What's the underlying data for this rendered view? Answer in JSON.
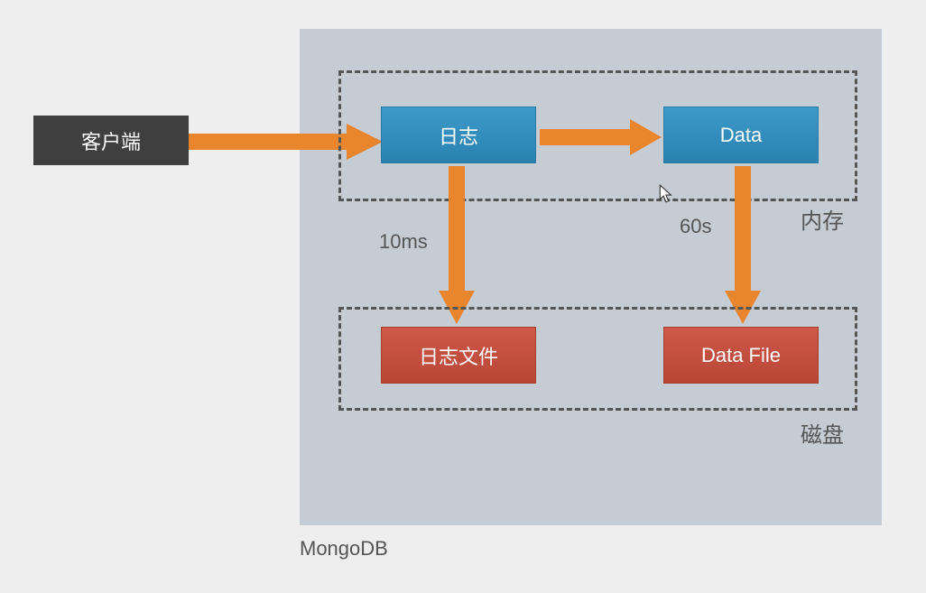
{
  "diagram": {
    "client": "客户端",
    "mongodb_label": "MongoDB",
    "memory_label": "内存",
    "disk_label": "磁盘",
    "log_box": "日志",
    "data_box": "Data",
    "logfile_box": "日志文件",
    "datafile_box": "Data File",
    "time_10ms": "10ms",
    "time_60s": "60s"
  },
  "chart_data": {
    "type": "diagram",
    "title": "MongoDB",
    "nodes": [
      {
        "id": "client",
        "label": "客户端",
        "group": null
      },
      {
        "id": "log",
        "label": "日志",
        "group": "内存"
      },
      {
        "id": "data",
        "label": "Data",
        "group": "内存"
      },
      {
        "id": "logfile",
        "label": "日志文件",
        "group": "磁盘"
      },
      {
        "id": "datafile",
        "label": "Data File",
        "group": "磁盘"
      }
    ],
    "groups": [
      {
        "id": "memory",
        "label": "内存"
      },
      {
        "id": "disk",
        "label": "磁盘"
      }
    ],
    "edges": [
      {
        "from": "client",
        "to": "log",
        "label": ""
      },
      {
        "from": "log",
        "to": "data",
        "label": ""
      },
      {
        "from": "log",
        "to": "logfile",
        "label": "10ms"
      },
      {
        "from": "data",
        "to": "datafile",
        "label": "60s"
      }
    ]
  }
}
